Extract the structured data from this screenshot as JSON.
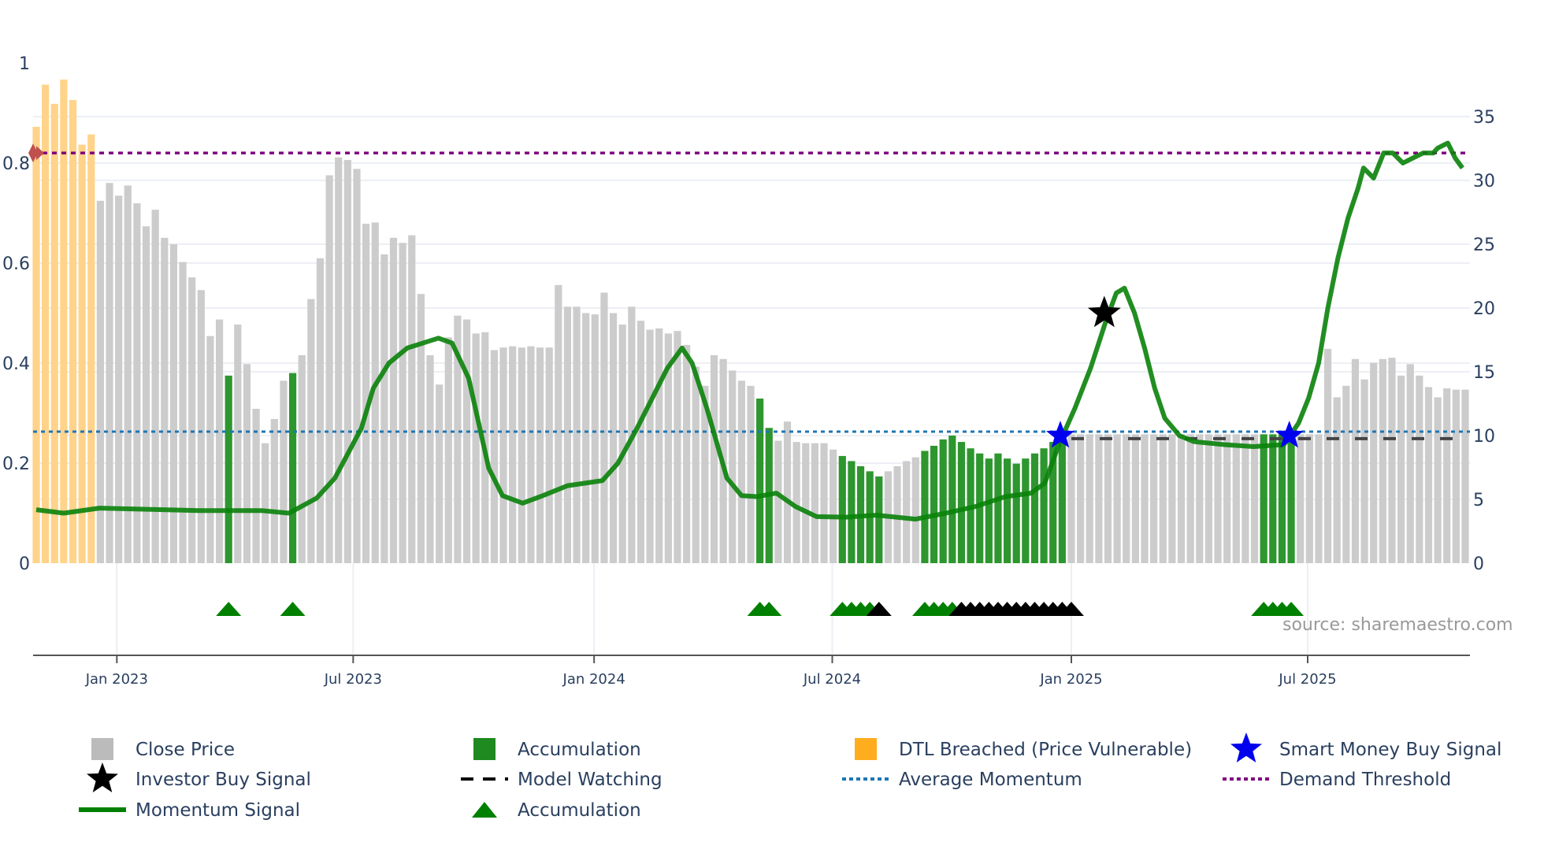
{
  "chart_data": {
    "type": "bar",
    "title": "",
    "source_note": "source: sharemaestro.com",
    "x_unit": "week index",
    "left_axis": {
      "range": [
        0,
        1
      ],
      "ticks": [
        0,
        0.2,
        0.4,
        0.6,
        0.8,
        1
      ],
      "tick_labels": [
        "0",
        "0.2",
        "0.4",
        "0.6",
        "0.8",
        "1"
      ]
    },
    "right_axis": {
      "range": [
        0,
        35
      ],
      "ticks": [
        0,
        5,
        10,
        15,
        20,
        25,
        30,
        35
      ],
      "tick_labels": [
        "0",
        "5",
        "10",
        "15",
        "20",
        "25",
        "30",
        "35"
      ]
    },
    "x_ticks": [
      {
        "week": 8.8,
        "label": "Jan 2023"
      },
      {
        "week": 34.6,
        "label": "Jul 2023"
      },
      {
        "week": 60.9,
        "label": "Jan 2024"
      },
      {
        "week": 86.9,
        "label": "Jul 2024"
      },
      {
        "week": 113.0,
        "label": "Jan 2025"
      },
      {
        "week": 138.8,
        "label": "Jul 2025"
      }
    ],
    "close_price": [
      34.2,
      37.5,
      36.0,
      37.9,
      36.3,
      32.8,
      33.6,
      28.4,
      29.8,
      28.8,
      29.6,
      28.2,
      26.4,
      27.7,
      25.5,
      25.0,
      23.6,
      22.4,
      21.4,
      17.8,
      19.1,
      14.7,
      18.7,
      15.6,
      12.1,
      9.4,
      11.3,
      14.3,
      14.9,
      16.3,
      20.7,
      23.9,
      30.4,
      31.8,
      31.6,
      30.9,
      26.6,
      26.7,
      24.2,
      25.5,
      25.1,
      25.7,
      21.1,
      16.3,
      14.0,
      17.7,
      19.4,
      19.1,
      18.0,
      18.1,
      16.7,
      16.9,
      17.0,
      16.9,
      17.0,
      16.9,
      16.9,
      21.8,
      20.1,
      20.1,
      19.6,
      19.5,
      21.2,
      19.6,
      18.7,
      20.1,
      19.0,
      18.3,
      18.4,
      18.0,
      18.2,
      17.1,
      15.4,
      13.9,
      16.3,
      16.0,
      15.1,
      14.3,
      13.9,
      12.9,
      10.6,
      9.6,
      11.1,
      9.5,
      9.4,
      9.4,
      9.4,
      8.9,
      8.4,
      8.0,
      7.6,
      7.2,
      6.8,
      7.2,
      7.6,
      8.0,
      8.3,
      8.8,
      9.2,
      9.7,
      10.0,
      9.5,
      9.0,
      8.6,
      8.2,
      8.6,
      8.2,
      7.8,
      8.2,
      8.6,
      9.0,
      9.5,
      10.0,
      10.1,
      10.1,
      10.1,
      10.1,
      10.1,
      10.1,
      10.1,
      10.1,
      10.1,
      10.1,
      10.1,
      10.1,
      10.1,
      10.1,
      10.1,
      10.1,
      10.1,
      10.1,
      10.1,
      10.1,
      10.1,
      10.1,
      10.1,
      10.1,
      10.1,
      10.1,
      10.1,
      10.1,
      16.8,
      13.0,
      13.9,
      16.0,
      14.4,
      15.7,
      16.0,
      16.1,
      14.7,
      15.6,
      14.7,
      13.8,
      13.0,
      13.7,
      13.6,
      13.6
    ],
    "dtl_breached_weeks": [
      0,
      1,
      2,
      3,
      4,
      5,
      6
    ],
    "accumulation_weeks": [
      21,
      28,
      79,
      80,
      88,
      89,
      90,
      91,
      92,
      97,
      98,
      99,
      100,
      101,
      102,
      103,
      104,
      105,
      106,
      107,
      108,
      109,
      110,
      111,
      112,
      134,
      135,
      136,
      137
    ],
    "momentum_signal": [
      [
        0,
        0.107
      ],
      [
        3,
        0.1
      ],
      [
        6.9,
        0.11
      ],
      [
        17.8,
        0.105
      ],
      [
        24.7,
        0.105
      ],
      [
        27.6,
        0.1
      ],
      [
        30.6,
        0.13
      ],
      [
        32.6,
        0.17
      ],
      [
        35.5,
        0.27
      ],
      [
        36.8,
        0.35
      ],
      [
        38.5,
        0.4
      ],
      [
        40.5,
        0.43
      ],
      [
        43.9,
        0.45
      ],
      [
        45.4,
        0.44
      ],
      [
        47.2,
        0.37
      ],
      [
        49.4,
        0.19
      ],
      [
        50.9,
        0.135
      ],
      [
        53.1,
        0.12
      ],
      [
        55.3,
        0.135
      ],
      [
        58,
        0.155
      ],
      [
        61.8,
        0.165
      ],
      [
        63.5,
        0.2
      ],
      [
        65.6,
        0.27
      ],
      [
        68.9,
        0.39
      ],
      [
        70.5,
        0.43
      ],
      [
        71.6,
        0.4
      ],
      [
        73.2,
        0.31
      ],
      [
        75.4,
        0.17
      ],
      [
        77,
        0.135
      ],
      [
        78.7,
        0.133
      ],
      [
        80.8,
        0.14
      ],
      [
        82.9,
        0.113
      ],
      [
        85.2,
        0.093
      ],
      [
        88.4,
        0.092
      ],
      [
        91.7,
        0.096
      ],
      [
        93.9,
        0.092
      ],
      [
        96,
        0.088
      ],
      [
        99.3,
        0.1
      ],
      [
        102.5,
        0.113
      ],
      [
        105.8,
        0.133
      ],
      [
        108.6,
        0.14
      ],
      [
        110.1,
        0.16
      ],
      [
        111.7,
        0.24
      ],
      [
        113.4,
        0.31
      ],
      [
        115.1,
        0.39
      ],
      [
        116.7,
        0.48
      ],
      [
        117.9,
        0.54
      ],
      [
        118.8,
        0.55
      ],
      [
        119.9,
        0.5
      ],
      [
        121,
        0.43
      ],
      [
        122.1,
        0.35
      ],
      [
        123.2,
        0.29
      ],
      [
        124.8,
        0.255
      ],
      [
        126.4,
        0.243
      ],
      [
        129.7,
        0.237
      ],
      [
        132.9,
        0.233
      ],
      [
        136.2,
        0.237
      ],
      [
        137.8,
        0.28
      ],
      [
        138.9,
        0.33
      ],
      [
        140,
        0.4
      ],
      [
        141,
        0.51
      ],
      [
        142.1,
        0.61
      ],
      [
        143.2,
        0.69
      ],
      [
        144.3,
        0.75
      ],
      [
        144.9,
        0.79
      ],
      [
        146,
        0.77
      ],
      [
        147.1,
        0.82
      ],
      [
        148.1,
        0.82
      ],
      [
        149.2,
        0.8
      ],
      [
        150.3,
        0.81
      ],
      [
        151.4,
        0.82
      ],
      [
        152.5,
        0.82
      ],
      [
        153,
        0.83
      ],
      [
        154.1,
        0.84
      ],
      [
        154.9,
        0.81
      ],
      [
        155.7,
        0.79
      ]
    ],
    "average_momentum": 0.263,
    "demand_threshold": 0.82,
    "model_watching": {
      "from_week": 113,
      "to_week": 156,
      "value": 0.249
    },
    "investor_buy_signals": [
      [
        116.6,
        0.5
      ]
    ],
    "smart_money_buy_signals": [
      [
        111.8,
        0.255
      ],
      [
        136.8,
        0.255
      ]
    ],
    "accumulation_markers": [
      {
        "week": 21,
        "color": "green"
      },
      {
        "week": 28,
        "color": "green"
      },
      {
        "week": 79,
        "color": "green"
      },
      {
        "week": 80,
        "color": "green"
      },
      {
        "week": 88,
        "color": "green"
      },
      {
        "week": 89,
        "color": "green"
      },
      {
        "week": 90,
        "color": "green"
      },
      {
        "week": 91,
        "color": "green"
      },
      {
        "week": 92,
        "color": "black"
      },
      {
        "week": 97,
        "color": "green"
      },
      {
        "week": 98,
        "color": "green"
      },
      {
        "week": 99,
        "color": "green"
      },
      {
        "week": 100,
        "color": "green"
      },
      {
        "week": 101,
        "color": "black"
      },
      {
        "week": 102,
        "color": "black"
      },
      {
        "week": 103,
        "color": "black"
      },
      {
        "week": 104,
        "color": "black"
      },
      {
        "week": 105,
        "color": "black"
      },
      {
        "week": 106,
        "color": "black"
      },
      {
        "week": 107,
        "color": "black"
      },
      {
        "week": 108,
        "color": "black"
      },
      {
        "week": 109,
        "color": "black"
      },
      {
        "week": 110,
        "color": "black"
      },
      {
        "week": 111,
        "color": "black"
      },
      {
        "week": 112,
        "color": "black"
      },
      {
        "week": 113,
        "color": "black"
      },
      {
        "week": 134,
        "color": "green"
      },
      {
        "week": 135,
        "color": "green"
      },
      {
        "week": 136,
        "color": "green"
      },
      {
        "week": 137,
        "color": "green"
      }
    ],
    "legend": [
      {
        "label": "Close Price",
        "symbol": "square",
        "color": "#bbbbbb"
      },
      {
        "label": "Accumulation",
        "symbol": "square",
        "color": "#1f8a1f"
      },
      {
        "label": "DTL Breached (Price Vulnerable)",
        "symbol": "square",
        "color": "#ffad1f"
      },
      {
        "label": "Smart Money Buy Signal",
        "symbol": "star",
        "color": "#0000ee"
      },
      {
        "label": "Investor Buy Signal",
        "symbol": "star",
        "color": "#000000"
      },
      {
        "label": "Model Watching",
        "symbol": "dash",
        "color": "#000000"
      },
      {
        "label": "Average Momentum",
        "symbol": "dot",
        "color": "#1f77b4"
      },
      {
        "label": "Demand Threshold",
        "symbol": "dot",
        "color": "#800080"
      },
      {
        "label": "Momentum Signal",
        "symbol": "line",
        "color": "#008000"
      },
      {
        "label": "Accumulation",
        "symbol": "triangle",
        "color": "#008000"
      }
    ],
    "colors": {
      "price": "#cccccc",
      "accumulation": "#2e962e",
      "dtl": "#ffd38a",
      "momentum": "#0a820a",
      "avg": "#1f77b4",
      "threshold": "#800080",
      "grid": "#eceff4"
    }
  }
}
